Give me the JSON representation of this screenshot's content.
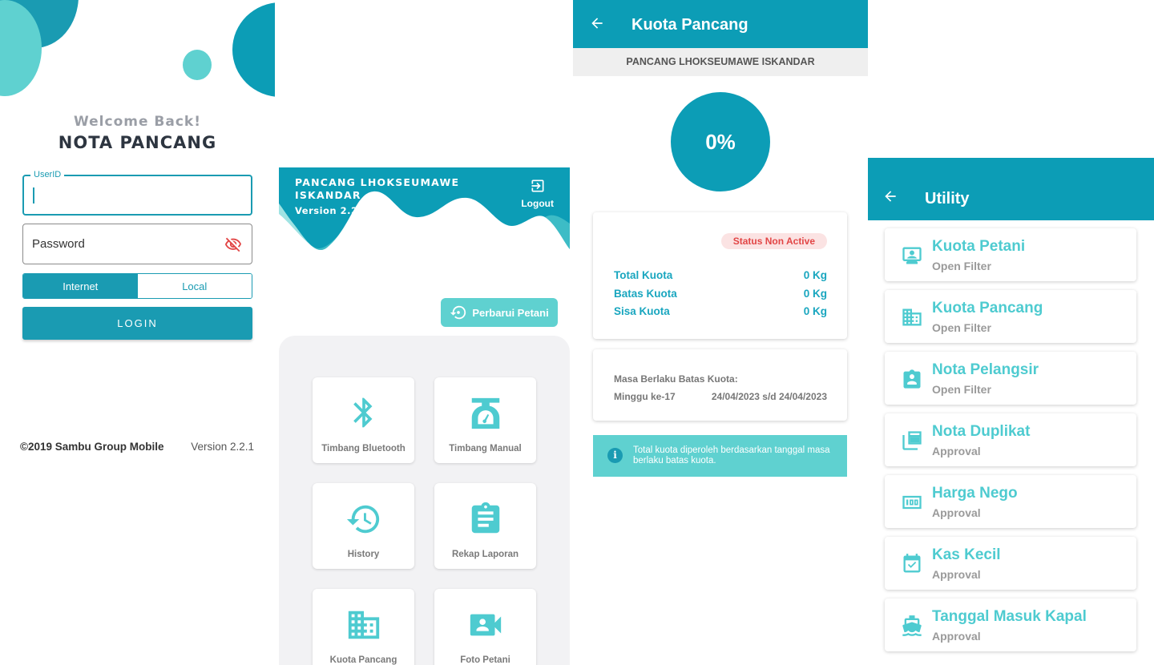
{
  "login": {
    "welcome": "Welcome Back!",
    "app_name": "NOTA PANCANG",
    "userid_label": "UserID",
    "userid_value": "",
    "password_placeholder": "Password",
    "mode_options": [
      "Internet",
      "Local"
    ],
    "mode_selected": "Internet",
    "login_button": "LOGIN",
    "copyright": "©2019 Sambu Group Mobile",
    "version": "Version 2.2.1"
  },
  "home": {
    "station": "PANCANG LHOKSEUMAWE ISKANDAR",
    "version": "Version 2.2.1",
    "logout": "Logout",
    "update_button": "Perbarui Petani",
    "menu": [
      {
        "label": "Timbang Bluetooth",
        "icon": "bluetooth-icon"
      },
      {
        "label": "Timbang Manual",
        "icon": "scale-icon"
      },
      {
        "label": "History",
        "icon": "history-icon"
      },
      {
        "label": "Rekap Laporan",
        "icon": "clipboard-icon"
      },
      {
        "label": "Kuota Pancang",
        "icon": "building-icon"
      },
      {
        "label": "Foto Petani",
        "icon": "camera-icon"
      }
    ]
  },
  "kuota": {
    "title": "Kuota Pancang",
    "station": "PANCANG LHOKSEUMAWE ISKANDAR",
    "percent": "0%",
    "percent_value": 0,
    "status": "Status Non Active",
    "rows": [
      {
        "label": "Total Kuota",
        "value": "0 Kg"
      },
      {
        "label": "Batas Kuota",
        "value": "0 Kg"
      },
      {
        "label": "Sisa Kuota",
        "value": "0 Kg"
      }
    ],
    "masa_label": "Masa Berlaku Batas Kuota:",
    "masa_week": "Minggu ke-17",
    "masa_range": "24/04/2023 s/d 24/04/2023",
    "info": "Total kuota diperoleh berdasarkan tanggal masa berlaku batas kuota."
  },
  "utility": {
    "title": "Utility",
    "items": [
      {
        "title": "Kuota Petani",
        "sub": "Open Filter",
        "icon": "person-card-icon"
      },
      {
        "title": "Kuota Pancang",
        "sub": "Open Filter",
        "icon": "building-icon"
      },
      {
        "title": "Nota Pelangsir",
        "sub": "Open Filter",
        "icon": "badge-icon"
      },
      {
        "title": "Nota Duplikat",
        "sub": "Approval",
        "icon": "copy-icon"
      },
      {
        "title": "Harga Nego",
        "sub": "Approval",
        "icon": "counter-icon"
      },
      {
        "title": "Kas Kecil",
        "sub": "Approval",
        "icon": "calendar-check-icon"
      },
      {
        "title": "Tanggal Masuk Kapal",
        "sub": "Approval",
        "icon": "ship-icon"
      }
    ]
  },
  "colors": {
    "primary": "#0c9db6",
    "accent": "#5fd1d0",
    "danger": "#e24646"
  }
}
